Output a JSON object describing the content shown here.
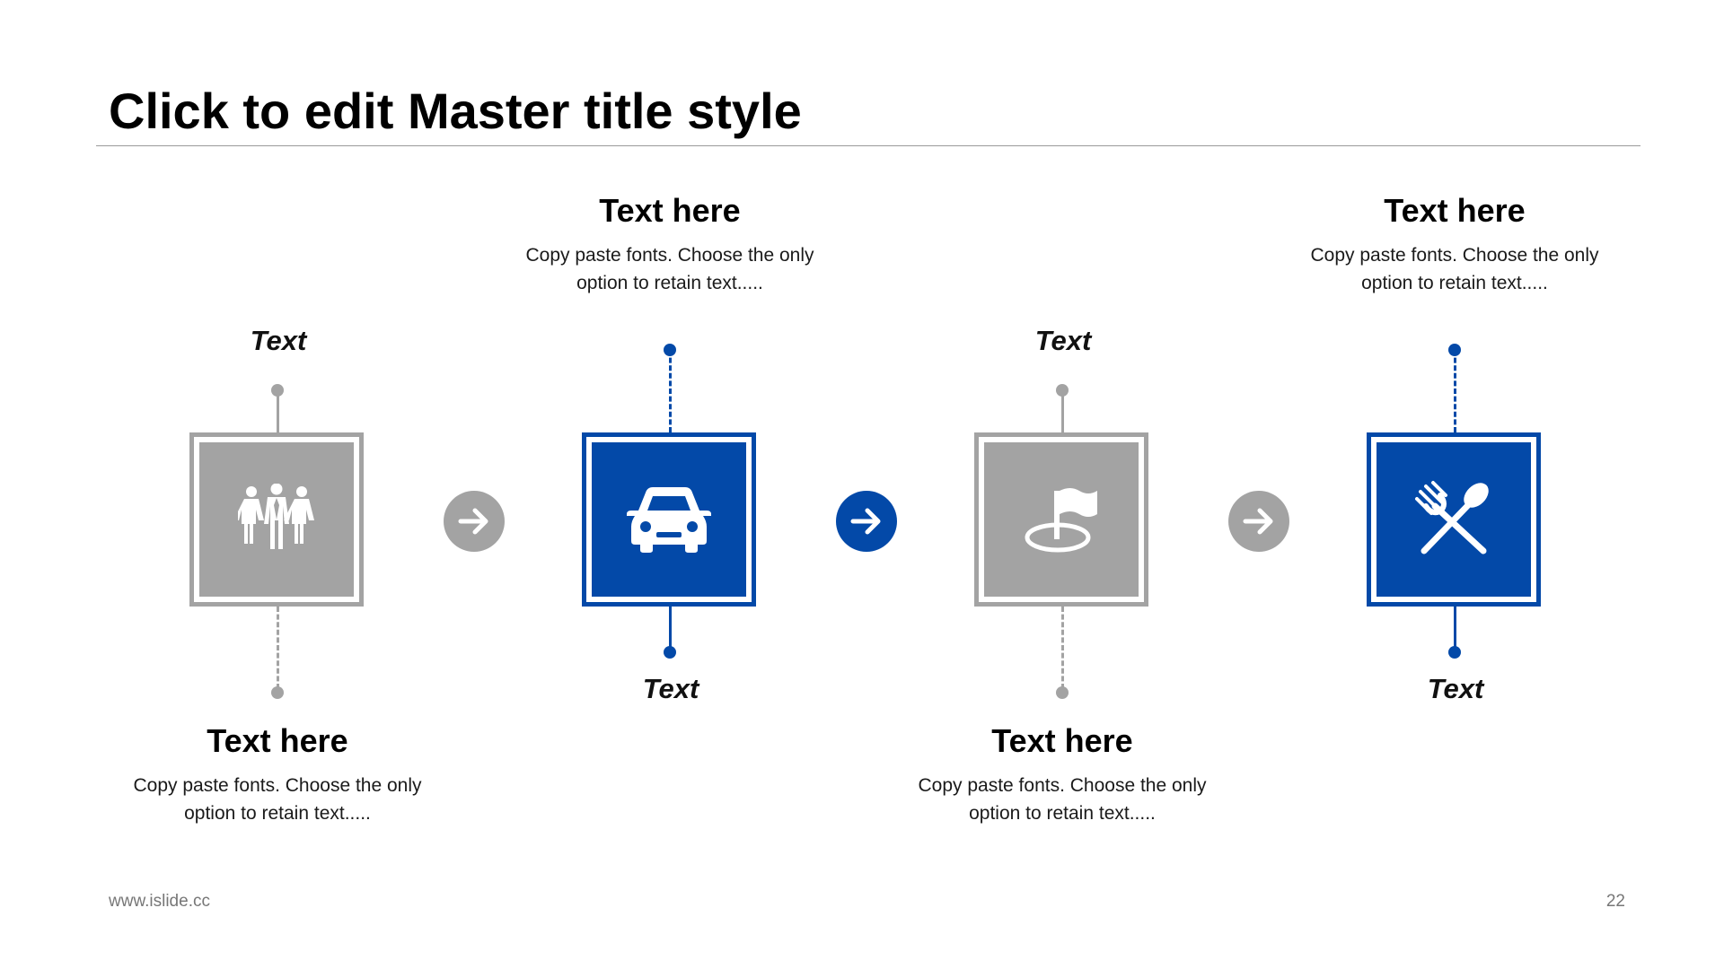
{
  "slide": {
    "title": "Click to edit Master title style",
    "footer_url": "www.islide.cc",
    "page_number": "22"
  },
  "colors": {
    "gray": "#a3a3a3",
    "blue": "#0349a8"
  },
  "steps": [
    {
      "icon": "people-group-icon",
      "color": "gray",
      "label": "Text",
      "heading": "Text here",
      "desc_line1": "Copy paste fonts. Choose the only",
      "desc_line2": "option to retain text....."
    },
    {
      "icon": "car-icon",
      "color": "blue",
      "label": "Text",
      "heading": "Text here",
      "desc_line1": "Copy paste fonts. Choose the only",
      "desc_line2": "option to retain text....."
    },
    {
      "icon": "flag-location-icon",
      "color": "gray",
      "label": "Text",
      "heading": "Text here",
      "desc_line1": "Copy paste fonts. Choose the only",
      "desc_line2": "option to retain text....."
    },
    {
      "icon": "fork-spoon-icon",
      "color": "blue",
      "label": "Text",
      "heading": "Text here",
      "desc_line1": "Copy paste fonts. Choose the only",
      "desc_line2": "option to retain text....."
    }
  ],
  "arrows": [
    {
      "icon": "arrow-right-icon",
      "color": "gray"
    },
    {
      "icon": "arrow-right-icon",
      "color": "blue"
    },
    {
      "icon": "arrow-right-icon",
      "color": "gray"
    }
  ]
}
